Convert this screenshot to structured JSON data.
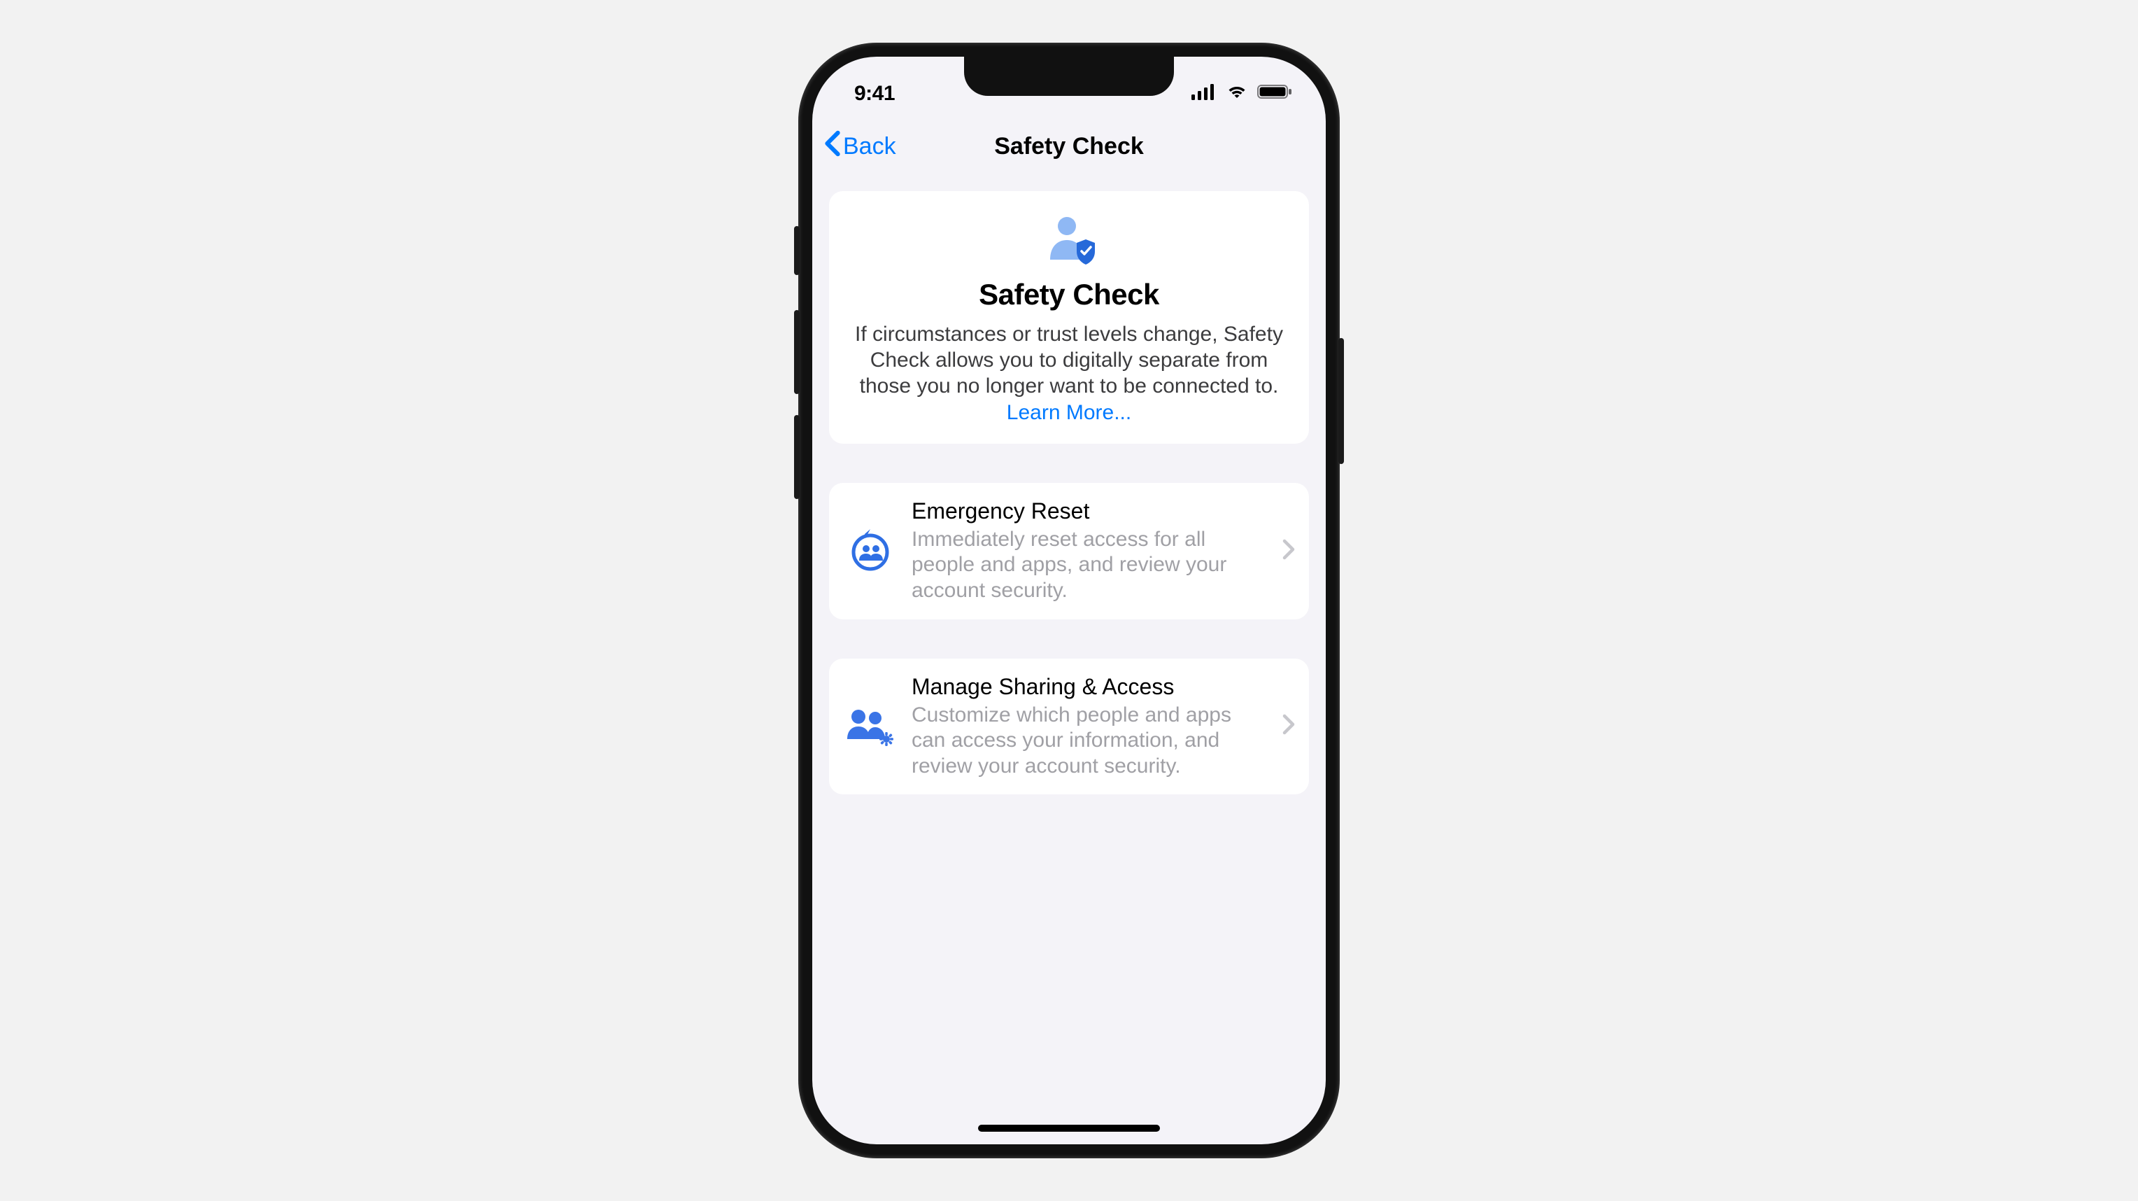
{
  "status": {
    "time": "9:41"
  },
  "nav": {
    "back_label": "Back",
    "title": "Safety Check"
  },
  "hero": {
    "title": "Safety Check",
    "description": "If circumstances or trust levels change, Safety Check allows you to digitally separate from those you no longer want to be connected to.",
    "learn_more": "Learn More..."
  },
  "options": [
    {
      "title": "Emergency Reset",
      "description": "Immediately reset access for all people and apps, and review your account security."
    },
    {
      "title": "Manage Sharing & Access",
      "description": "Customize which people and apps can access your information, and review your account security."
    }
  ]
}
